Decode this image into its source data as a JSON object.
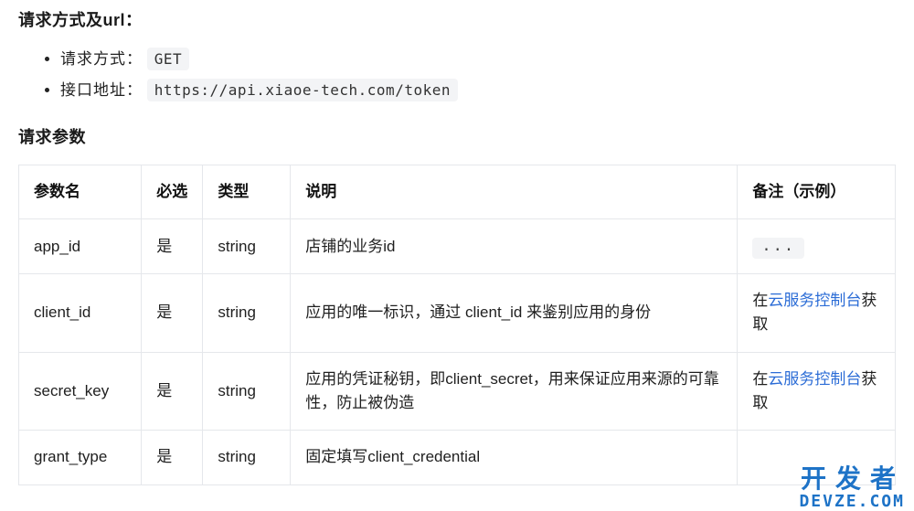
{
  "sections": {
    "request_url_title": "请求方式及url：",
    "request_method_label": "请求方式：",
    "request_method_value": "GET",
    "api_url_label": "接口地址：",
    "api_url_value": "https://api.xiaoe-tech.com/token",
    "params_title": "请求参数"
  },
  "table": {
    "headers": {
      "name": "参数名",
      "required": "必选",
      "type": "类型",
      "desc": "说明",
      "remark": "备注（示例）"
    },
    "rows": [
      {
        "name": "app_id",
        "required": "是",
        "type": "string",
        "desc": "店铺的业务id",
        "remark_type": "ellipsis",
        "remark_text": "..."
      },
      {
        "name": "client_id",
        "required": "是",
        "type": "string",
        "desc": "应用的唯一标识，通过 client_id 来鉴别应用的身份",
        "remark_type": "link",
        "remark_prefix": "在",
        "remark_link": "云服务控制台",
        "remark_suffix": "获取"
      },
      {
        "name": "secret_key",
        "required": "是",
        "type": "string",
        "desc": "应用的凭证秘钥，即client_secret，用来保证应用来源的可靠性，防止被伪造",
        "remark_type": "link",
        "remark_prefix": "在",
        "remark_link": "云服务控制台",
        "remark_suffix": "获取"
      },
      {
        "name": "grant_type",
        "required": "是",
        "type": "string",
        "desc": "固定填写client_credential",
        "remark_type": "none",
        "remark_text": ""
      }
    ]
  },
  "watermark": {
    "line1": "开发者",
    "line2": "DEVZE.COM"
  }
}
